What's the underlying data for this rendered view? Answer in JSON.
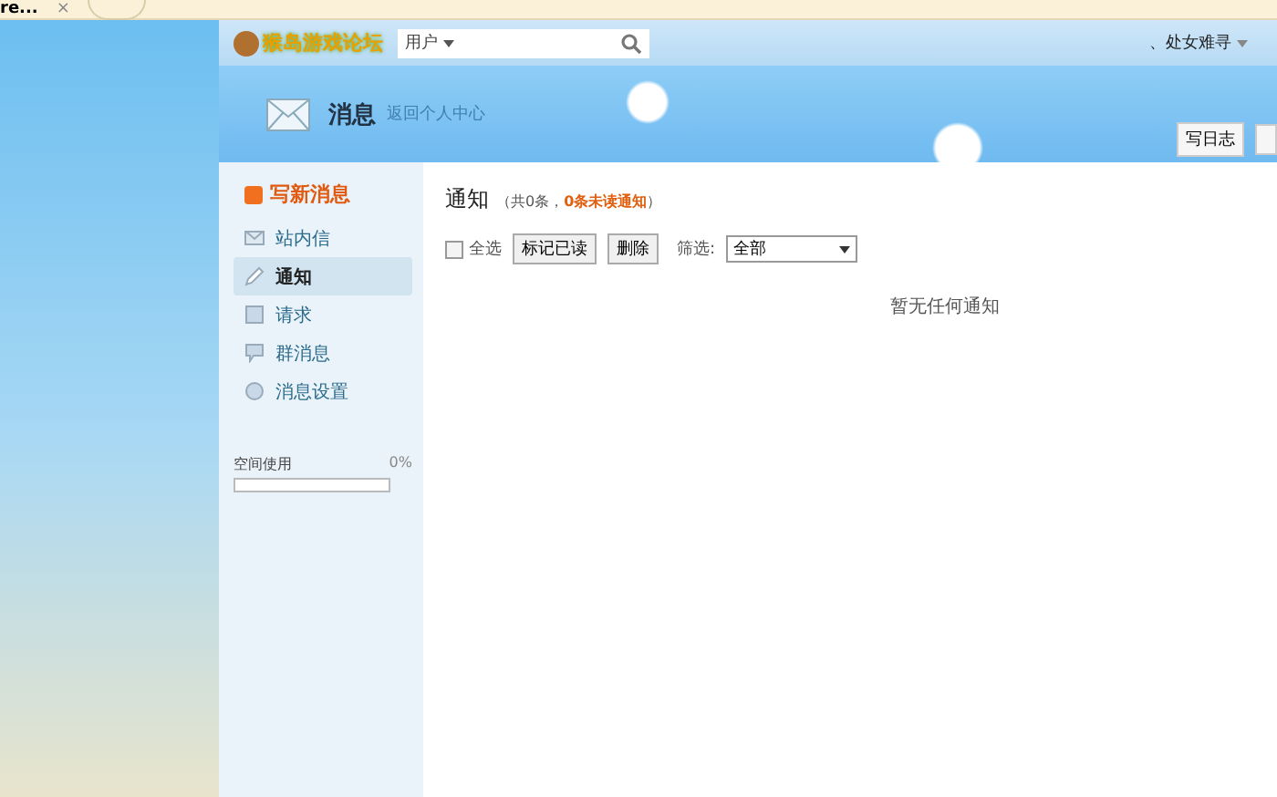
{
  "browser_tab": {
    "title": "re...",
    "close": "×"
  },
  "header": {
    "logo": "猴岛游戏论坛",
    "search": {
      "scope": "用户"
    },
    "user": "、处女难寻"
  },
  "banner": {
    "title": "消息",
    "link": "返回个人中心",
    "actions": [
      "写日志"
    ]
  },
  "sidebar": {
    "compose": "写新消息",
    "items": [
      {
        "label": "站内信",
        "kind": "mail",
        "selected": false
      },
      {
        "label": "通知",
        "kind": "pencil",
        "selected": true
      },
      {
        "label": "请求",
        "kind": "note",
        "selected": false
      },
      {
        "label": "群消息",
        "kind": "chat",
        "selected": false
      },
      {
        "label": "消息设置",
        "kind": "dot",
        "selected": false
      }
    ],
    "usage": {
      "label": "空间使用",
      "reading": "0%",
      "level": 0
    }
  },
  "main": {
    "title": "通知",
    "summary_prefix": "（共0条，",
    "summary_highlight": "0条未读通知",
    "summary_suffix": "）",
    "select_all": {
      "label": "全选",
      "checked": false
    },
    "buttons": [
      "标记已读",
      "删除"
    ],
    "filter": {
      "label": "筛选:",
      "value": "全部"
    },
    "empty": "暂无任何通知"
  }
}
